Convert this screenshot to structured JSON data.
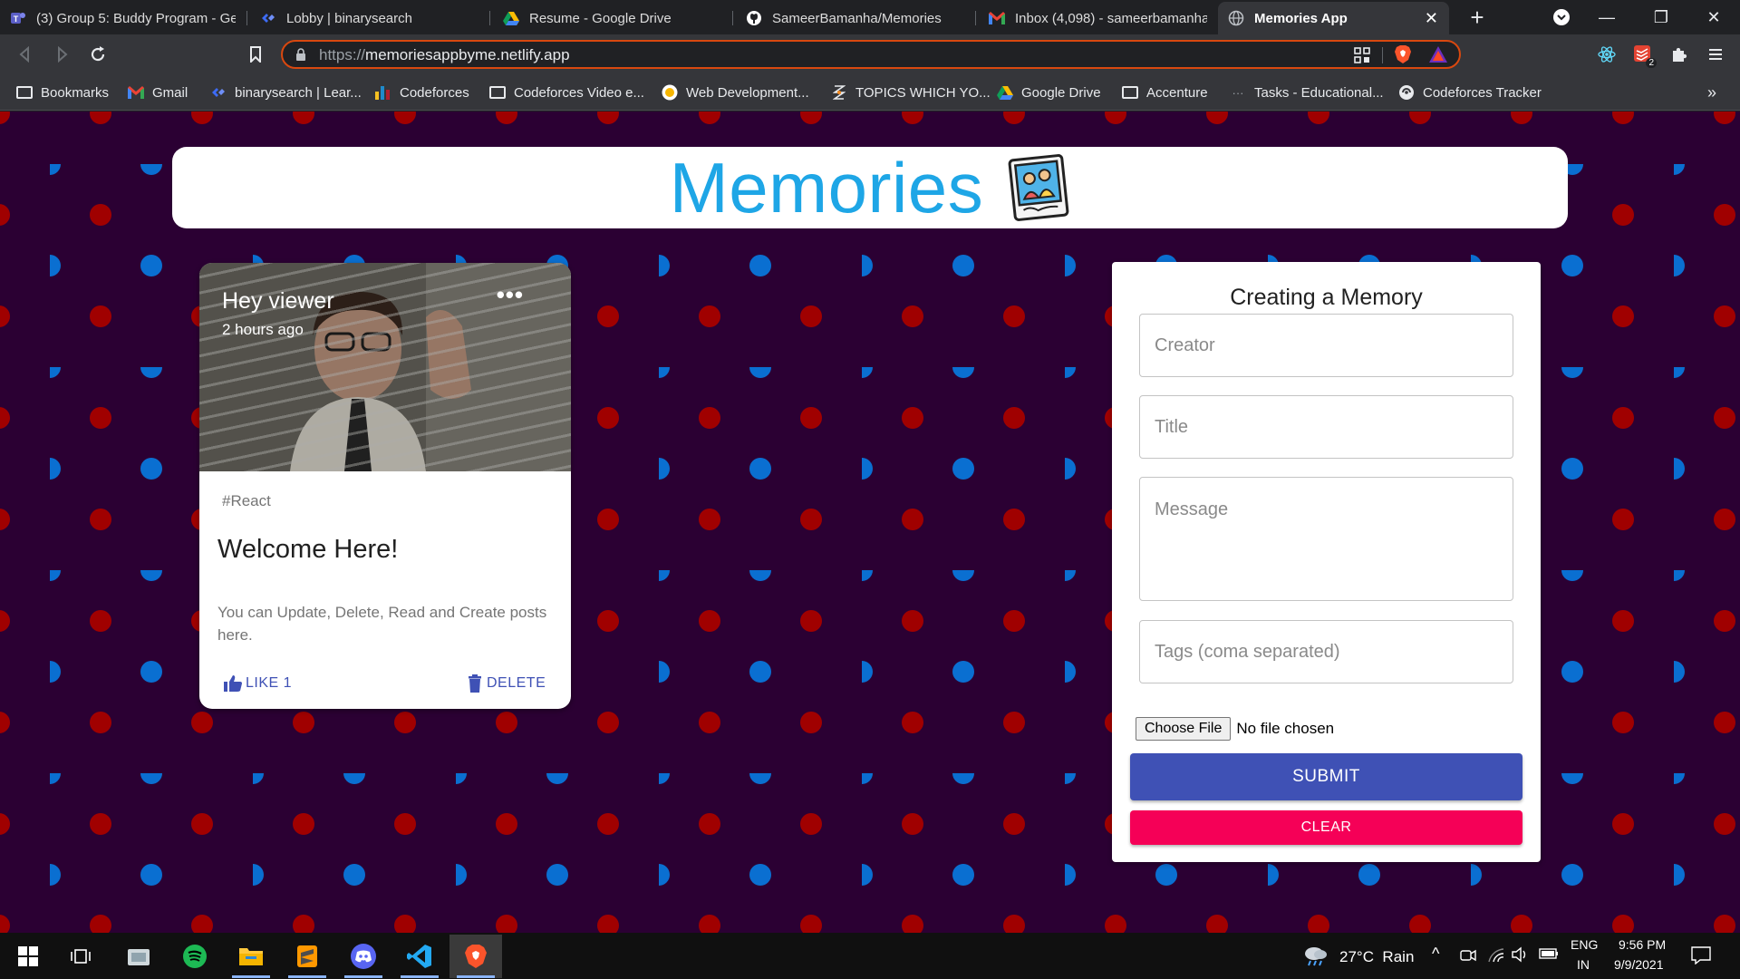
{
  "browser": {
    "tabs": [
      {
        "label": "(3) Group 5: Buddy Program - Ge",
        "icon": "teams-icon"
      },
      {
        "label": "Lobby | binarysearch",
        "icon": "binarysearch-icon"
      },
      {
        "label": "Resume - Google Drive",
        "icon": "google-drive-icon"
      },
      {
        "label": "SameerBamanha/Memories",
        "icon": "github-icon"
      },
      {
        "label": "Inbox (4,098) - sameerbamanha@",
        "icon": "gmail-icon"
      },
      {
        "label": "Memories App",
        "icon": "globe-icon",
        "active": true
      }
    ],
    "url_scheme": "https://",
    "url_host": "memoriesappbyme.netlify.app",
    "extension_badge": "2",
    "bookmarks": [
      {
        "label": "Bookmarks",
        "icon": "folder-icon"
      },
      {
        "label": "Gmail",
        "icon": "gmail-icon"
      },
      {
        "label": "binarysearch | Lear...",
        "icon": "binarysearch-icon"
      },
      {
        "label": "Codeforces",
        "icon": "codeforces-icon"
      },
      {
        "label": "Codeforces Video e...",
        "icon": "folder-icon"
      },
      {
        "label": "Web Development...",
        "icon": "webdev-icon"
      },
      {
        "label": "TOPICS WHICH YO...",
        "icon": "topics-icon"
      },
      {
        "label": "Google Drive",
        "icon": "google-drive-icon"
      },
      {
        "label": "Accenture",
        "icon": "folder-icon"
      },
      {
        "label": "Tasks - Educational...",
        "icon": "tasks-icon"
      },
      {
        "label": "Codeforces Tracker",
        "icon": "tracker-icon"
      }
    ],
    "more_bookmarks": "»"
  },
  "app": {
    "title": "Memories",
    "logo": "memories-photo-icon",
    "colors": {
      "title": "#1ea6e6",
      "primary": "#3f51b5",
      "secondary": "#f50057",
      "bg": "#2b0033",
      "dot_red": "#a00000",
      "dot_blue": "#0a6fd1"
    }
  },
  "post": {
    "creator": "Hey viewer",
    "time": "2 hours ago",
    "more": "•••",
    "tags": "#React",
    "title": "Welcome Here!",
    "message": "You can Update, Delete, Read and Create posts here.",
    "like_label": "LIKE 1",
    "delete_label": "DELETE"
  },
  "form": {
    "heading": "Creating a Memory",
    "creator_placeholder": "Creator",
    "title_placeholder": "Title",
    "message_placeholder": "Message",
    "tags_placeholder": "Tags (coma separated)",
    "file_button": "Choose File",
    "file_status": "No file chosen",
    "submit_label": "SUBMIT",
    "clear_label": "CLEAR"
  },
  "taskbar": {
    "weather": "27°C  Rain",
    "lang_top": "ENG",
    "lang_bottom": "IN",
    "time": "9:56 PM",
    "date": "9/9/2021"
  }
}
